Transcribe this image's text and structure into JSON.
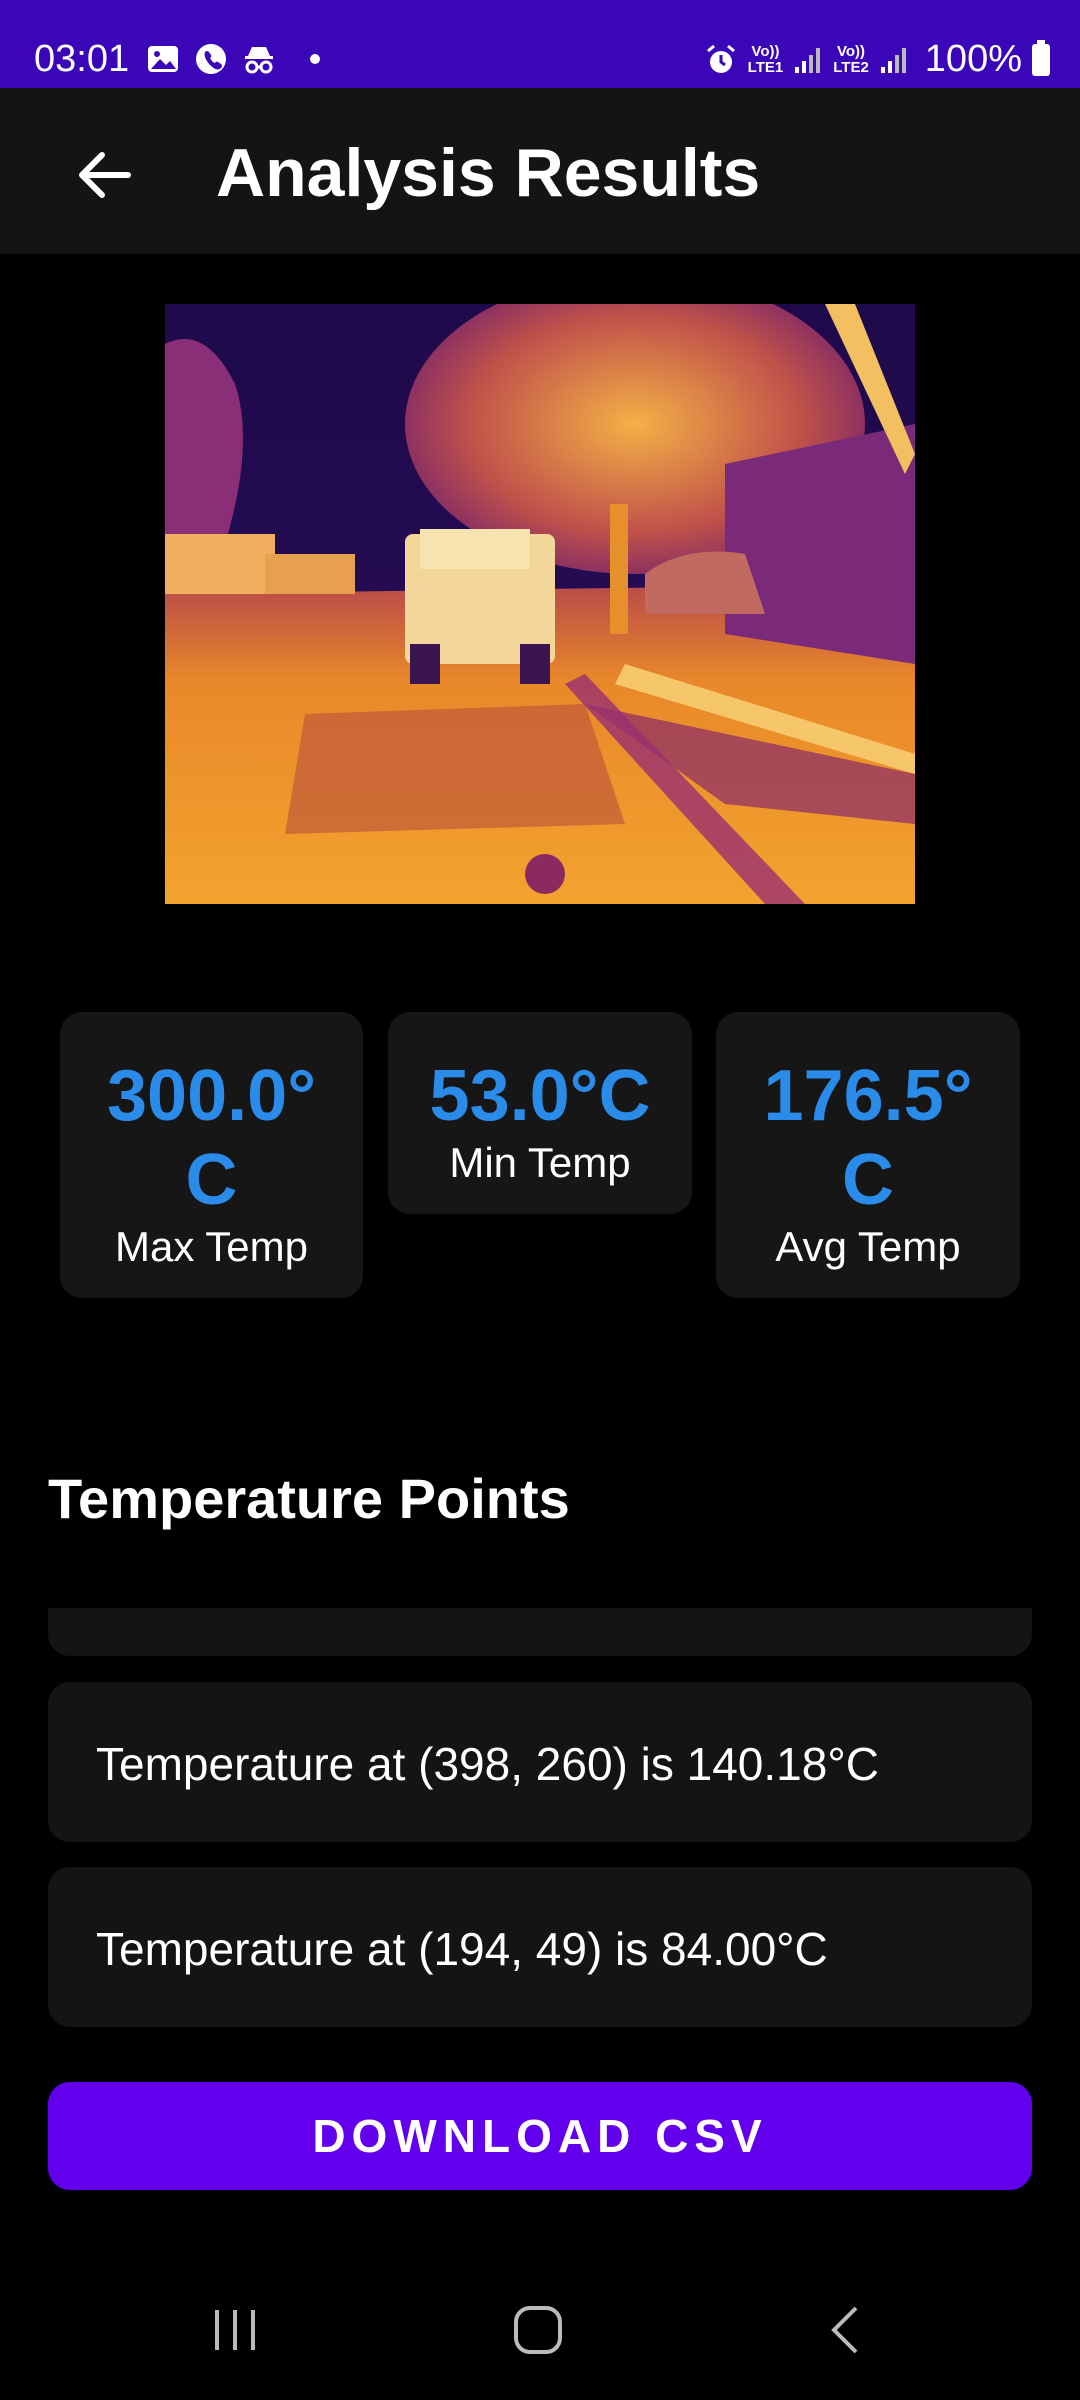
{
  "status_bar": {
    "time": "03:01",
    "sim1_label_top": "Vo))",
    "sim1_label_bottom": "LTE1",
    "sim2_label_top": "Vo))",
    "sim2_label_bottom": "LTE2",
    "battery": "100%"
  },
  "app_bar": {
    "title": "Analysis Results",
    "back_icon": "arrow-left-icon"
  },
  "stats": {
    "max": {
      "value": "300.0°C",
      "label": "Max Temp"
    },
    "min": {
      "value": "53.0°C",
      "label": "Min Temp"
    },
    "avg": {
      "value": "176.5°C",
      "label": "Avg Temp"
    }
  },
  "section_title": "Temperature Points",
  "temperature_points": [
    "Temperature at (398, 260) is 140.18°C",
    "Temperature at (194, 49) is 84.00°C"
  ],
  "download_button": "DOWNLOAD CSV",
  "colors": {
    "status_bar": "#3a06b8",
    "accent": "#6200ee",
    "value_blue": "#2a8be8"
  }
}
